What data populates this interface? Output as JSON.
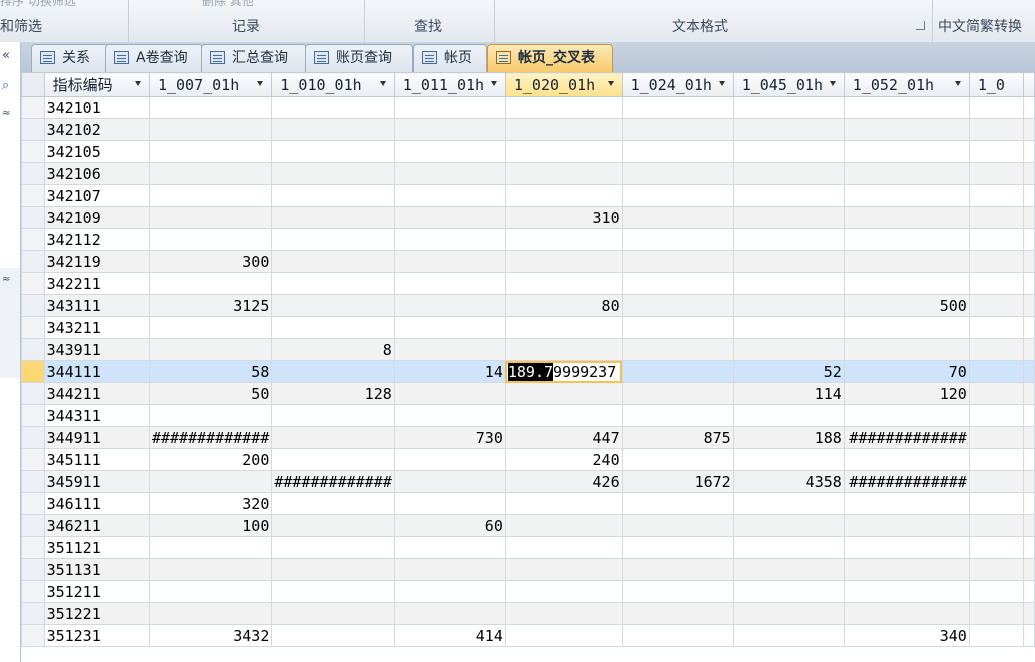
{
  "ribbon": {
    "groups": [
      {
        "top_text": "排序 切换筛选",
        "caption": "和筛选"
      },
      {
        "top_text": "删除 其他",
        "caption": "记录"
      },
      {
        "top_text": "",
        "caption": "查找"
      },
      {
        "top_text": "",
        "caption": "文本格式"
      },
      {
        "top_text": "",
        "caption": "中文简繁转换"
      }
    ]
  },
  "navpane": {
    "collapse_glyph": "«",
    "search_glyph": "⌕",
    "chevron_glyph": "≈"
  },
  "tabs": [
    {
      "label": "关系",
      "active": false
    },
    {
      "label": "A卷查询",
      "active": false
    },
    {
      "label": "汇总查询",
      "active": false
    },
    {
      "label": "账页查询",
      "active": false
    },
    {
      "label": "帐页",
      "active": false
    },
    {
      "label": "帐页_交叉表",
      "active": true
    }
  ],
  "grid": {
    "columns": [
      "指标编码",
      "1_007_01h",
      "1_010_01h",
      "1_011_01h",
      "1_020_01h",
      "1_024_01h",
      "1_045_01h",
      "1_052_01h",
      "1_0"
    ],
    "selected_column": 4,
    "current_row": 12,
    "editing_cell": {
      "row": 12,
      "col": 4,
      "selected_part": "189.7",
      "rest": "9999237"
    },
    "rows": [
      [
        "342101",
        "",
        "",
        "",
        "",
        "",
        "",
        "",
        ""
      ],
      [
        "342102",
        "",
        "",
        "",
        "",
        "",
        "",
        "",
        ""
      ],
      [
        "342105",
        "",
        "",
        "",
        "",
        "",
        "",
        "",
        ""
      ],
      [
        "342106",
        "",
        "",
        "",
        "",
        "",
        "",
        "",
        ""
      ],
      [
        "342107",
        "",
        "",
        "",
        "",
        "",
        "",
        "",
        ""
      ],
      [
        "342109",
        "",
        "",
        "",
        "310",
        "",
        "",
        "",
        ""
      ],
      [
        "342112",
        "",
        "",
        "",
        "",
        "",
        "",
        "",
        ""
      ],
      [
        "342119",
        "300",
        "",
        "",
        "",
        "",
        "",
        "",
        ""
      ],
      [
        "342211",
        "",
        "",
        "",
        "",
        "",
        "",
        "",
        ""
      ],
      [
        "343111",
        "3125",
        "",
        "",
        "80",
        "",
        "",
        "500",
        ""
      ],
      [
        "343211",
        "",
        "",
        "",
        "",
        "",
        "",
        "",
        ""
      ],
      [
        "343911",
        "",
        "8",
        "",
        "",
        "",
        "",
        "",
        ""
      ],
      [
        "344111",
        "58",
        "",
        "14",
        "189.79999237",
        "",
        "52",
        "70",
        ""
      ],
      [
        "344211",
        "50",
        "128",
        "",
        "",
        "",
        "114",
        "120",
        ""
      ],
      [
        "344311",
        "",
        "",
        "",
        "",
        "",
        "",
        "",
        ""
      ],
      [
        "344911",
        "#############",
        "",
        "730",
        "447",
        "875",
        "188",
        "#############",
        ""
      ],
      [
        "345111",
        "200",
        "",
        "",
        "240",
        "",
        "",
        "",
        ""
      ],
      [
        "345911",
        "",
        "#############",
        "",
        "426",
        "1672",
        "4358",
        "#############",
        ""
      ],
      [
        "346111",
        "320",
        "",
        "",
        "",
        "",
        "",
        "",
        ""
      ],
      [
        "346211",
        "100",
        "",
        "60",
        "",
        "",
        "",
        "",
        ""
      ],
      [
        "351121",
        "",
        "",
        "",
        "",
        "",
        "",
        "",
        ""
      ],
      [
        "351131",
        "",
        "",
        "",
        "",
        "",
        "",
        "",
        ""
      ],
      [
        "351211",
        "",
        "",
        "",
        "",
        "",
        "",
        "",
        ""
      ],
      [
        "351221",
        "",
        "",
        "",
        "",
        "",
        "",
        "",
        ""
      ],
      [
        "351231",
        "3432",
        "",
        "414",
        "",
        "",
        "",
        "340",
        ""
      ]
    ]
  }
}
